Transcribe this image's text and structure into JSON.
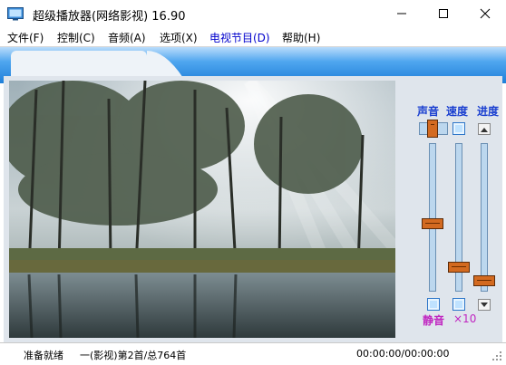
{
  "window": {
    "title": "超级播放器(网络影视) 16.90"
  },
  "menu": [
    {
      "label": "文件(F)"
    },
    {
      "label": "控制(C)"
    },
    {
      "label": "音频(A)"
    },
    {
      "label": "选项(X)"
    },
    {
      "label": "电视节目(D)",
      "active": true
    },
    {
      "label": "帮助(H)"
    }
  ],
  "controls": {
    "volume_label": "声音",
    "speed_label": "速度",
    "progress_label": "进度",
    "mute_label": "静音",
    "speed_multiplier": "×10",
    "volume_level": 0.55,
    "speed_level": 0.87,
    "progress_level": 0.97
  },
  "status": {
    "state": "准备就绪",
    "playlist": "一(影视)第2首/总764首",
    "time": "00:00:00/00:00:00"
  },
  "colors": {
    "accent": "#1a3fd0",
    "mute": "#c025c0",
    "band": "#1f7fd9"
  }
}
